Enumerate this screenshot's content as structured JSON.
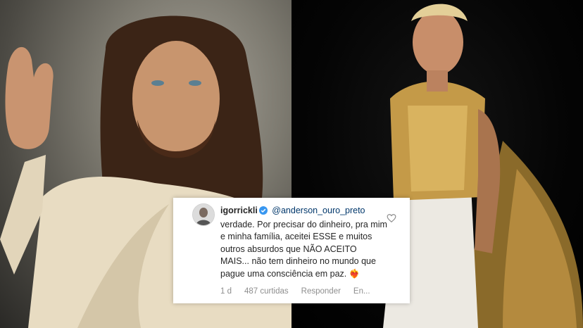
{
  "comment": {
    "username": "igorrickli",
    "mention": "@anderson_ouro_preto",
    "text": "verdade. Por precisar do dinheiro, pra mim e minha família, aceitei ESSE e muitos outros absurdos que NÃO ACEITO MAIS... não tem dinheiro no mundo que pague uma consciência em paz.",
    "emoji": "❤️‍🔥",
    "age": "1 d",
    "likes": "487 curtidas",
    "reply_label": "Responder",
    "more_label": "En..."
  },
  "colors": {
    "mention": "#00376b",
    "meta": "#8e8e8e",
    "verified": "#3897f0"
  },
  "icons": {
    "verified": "verified-badge-icon",
    "like": "heart-icon"
  }
}
